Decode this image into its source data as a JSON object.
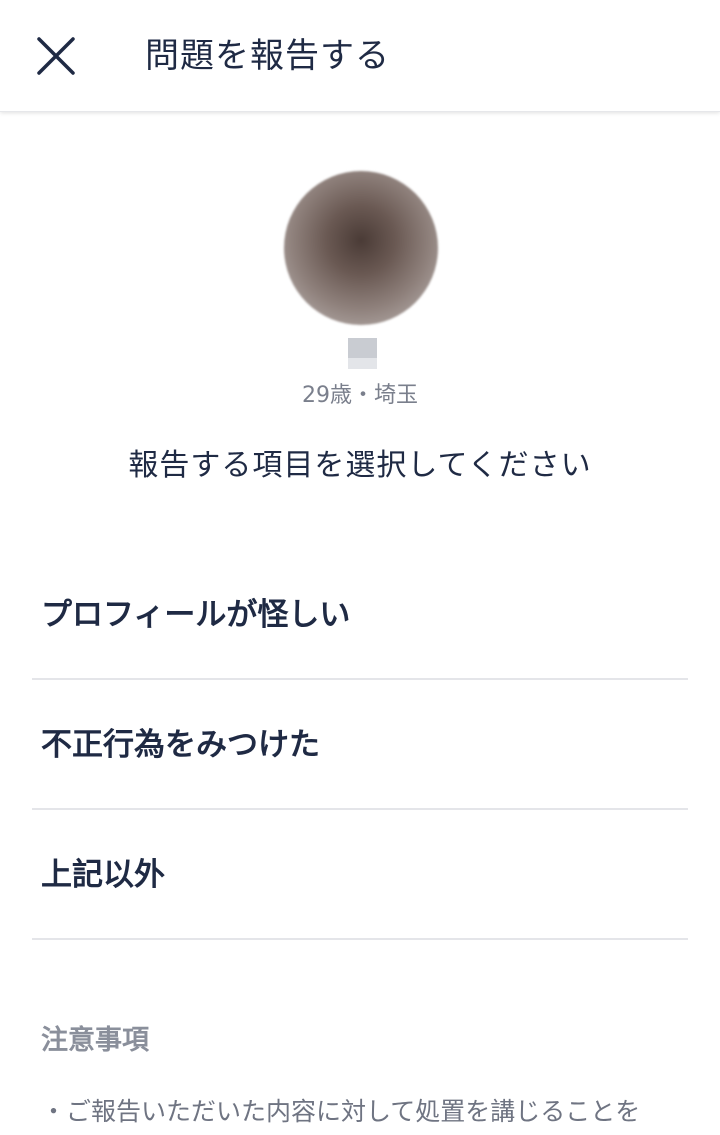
{
  "header": {
    "title": "問題を報告する",
    "close_icon": "close-icon"
  },
  "profile": {
    "meta": "29歳・埼玉"
  },
  "prompt": "報告する項目を選択してください",
  "options": [
    {
      "label": "プロフィールが怪しい"
    },
    {
      "label": "不正行為をみつけた"
    },
    {
      "label": "上記以外"
    }
  ],
  "notes": {
    "title": "注意事項",
    "items": [
      "・ご報告いただいた内容に対して処置を講じることを"
    ]
  },
  "colors": {
    "text_primary": "#1f2a44",
    "text_secondary": "#7a7f8c",
    "divider": "#e4e5e9"
  }
}
